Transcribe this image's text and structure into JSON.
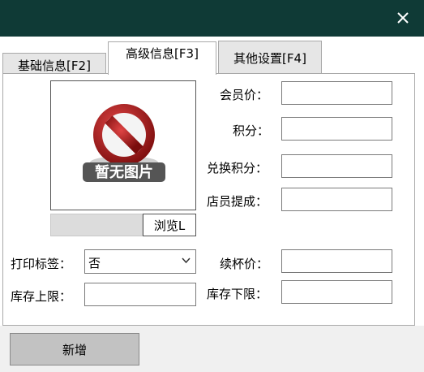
{
  "window": {
    "close_icon": "close-icon",
    "titlebar_color": "#0f3a36"
  },
  "tabs": [
    {
      "label": "基础信息[F2]",
      "active": false
    },
    {
      "label": "高级信息[F3]",
      "active": true
    },
    {
      "label": "其他设置[F4]",
      "active": false
    }
  ],
  "image": {
    "placeholder_icon": "no-image-icon",
    "placeholder_text": "暂无图片",
    "browse_label": "浏览L",
    "path_value": ""
  },
  "form": {
    "member_price_label": "会员价：",
    "member_price_value": "",
    "points_label": "积分：",
    "points_value": "",
    "redeem_points_label": "兑换积分：",
    "redeem_points_value": "",
    "staff_commission_label": "店员提成：",
    "staff_commission_value": "",
    "print_label_label": "打印标签：",
    "print_label_value": "否",
    "refill_price_label": "续杯价：",
    "refill_price_value": "",
    "stock_upper_label": "库存上限：",
    "stock_upper_value": "",
    "stock_lower_label": "库存下限：",
    "stock_lower_value": ""
  },
  "actions": {
    "add_label": "新增"
  }
}
